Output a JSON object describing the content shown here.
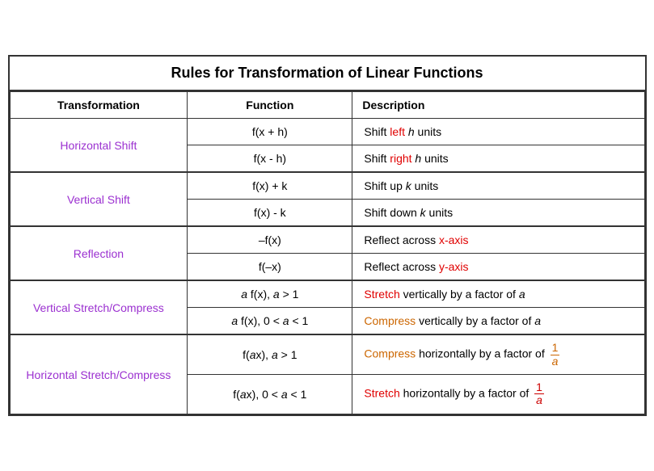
{
  "title": "Rules for Transformation of Linear Functions",
  "headers": {
    "transformation": "Transformation",
    "function": "Function",
    "description": "Description"
  },
  "rows": [
    {
      "group": "Horizontal Shift",
      "subrows": [
        {
          "function": "f(x + h)",
          "desc_plain": "Shift left h units",
          "highlight": {
            "word": "left",
            "color": "red"
          }
        },
        {
          "function": "f(x  - h)",
          "desc_plain": "Shift right h units",
          "highlight": {
            "word": "right",
            "color": "red"
          }
        }
      ]
    },
    {
      "group": "Vertical Shift",
      "subrows": [
        {
          "function": "f(x) + k",
          "desc_plain": "Shift up k units",
          "highlight": {
            "word": "up",
            "color": "black"
          }
        },
        {
          "function": "f(x) - k",
          "desc_plain": "Shift down k units",
          "highlight": {
            "word": "down",
            "color": "black"
          }
        }
      ]
    },
    {
      "group": "Reflection",
      "subrows": [
        {
          "function": "–f(x)",
          "desc_plain": "Reflect across x-axis",
          "highlight": {
            "word": "x-axis",
            "color": "red"
          }
        },
        {
          "function": "f(–x)",
          "desc_plain": "Reflect across y-axis",
          "highlight": {
            "word": "y-axis",
            "color": "red"
          }
        }
      ]
    },
    {
      "group": "Vertical Stretch/Compress",
      "subrows": [
        {
          "function": "a f(x), a > 1",
          "desc_plain": "Stretch vertically by a factor of a",
          "highlight": {
            "word": "Stretch",
            "color": "red"
          }
        },
        {
          "function": "a f(x), 0 < a < 1",
          "desc_plain": "Compress vertically by a factor of a",
          "highlight": {
            "word": "Compress",
            "color": "orange"
          }
        }
      ]
    },
    {
      "group": "Horizontal Stretch/Compress",
      "subrows": [
        {
          "function": "f(ax), a > 1",
          "desc_type": "fraction",
          "desc_prefix": "Compress horizontally by a factor of",
          "highlight_word": "Compress",
          "highlight_color": "orange"
        },
        {
          "function": "f(ax), 0 < a < 1",
          "desc_type": "fraction",
          "desc_prefix": "Stretch horizontally by a factor of",
          "highlight_word": "Stretch",
          "highlight_color": "red"
        }
      ]
    }
  ]
}
